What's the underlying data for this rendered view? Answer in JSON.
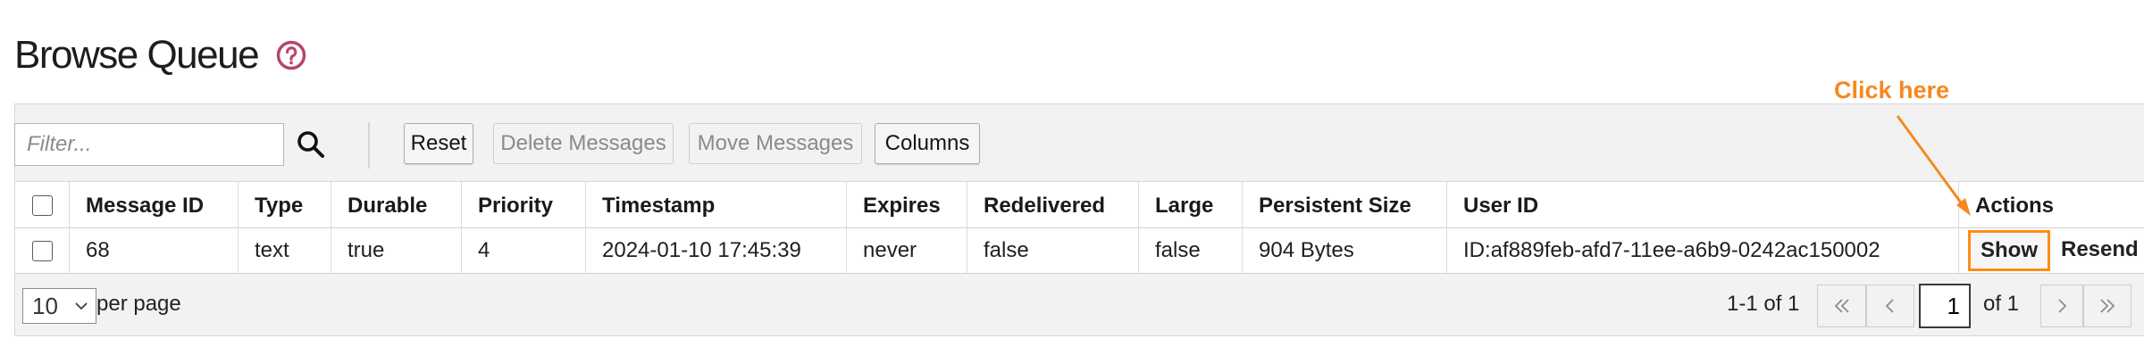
{
  "page": {
    "title": "Browse Queue",
    "help_icon": "question-circle-icon",
    "accent_color": "#b6456f"
  },
  "toolbar": {
    "filter_placeholder": "Filter...",
    "search_icon": "search-icon",
    "reset_label": "Reset",
    "delete_label": "Delete Messages",
    "move_label": "Move Messages",
    "columns_label": "Columns"
  },
  "table": {
    "headers": [
      "Message ID",
      "Type",
      "Durable",
      "Priority",
      "Timestamp",
      "Expires",
      "Redelivered",
      "Large",
      "Persistent Size",
      "User ID",
      "Actions"
    ],
    "rows": [
      {
        "message_id": "68",
        "type": "text",
        "durable": "true",
        "priority": "4",
        "timestamp": "2024-01-10 17:45:39",
        "expires": "never",
        "redelivered": "false",
        "large": "false",
        "persistent_size": "904 Bytes",
        "user_id": "ID:af889feb-afd7-11ee-a6b9-0242ac150002",
        "show_label": "Show",
        "resend_label": "Resend"
      }
    ]
  },
  "pagination": {
    "per_page_value": "10",
    "per_page_label": "per page",
    "range_text": "1-1 of 1",
    "current_page": "1",
    "of_text": "of 1"
  },
  "annotation": {
    "text": "Click here",
    "color": "#f5891f"
  }
}
